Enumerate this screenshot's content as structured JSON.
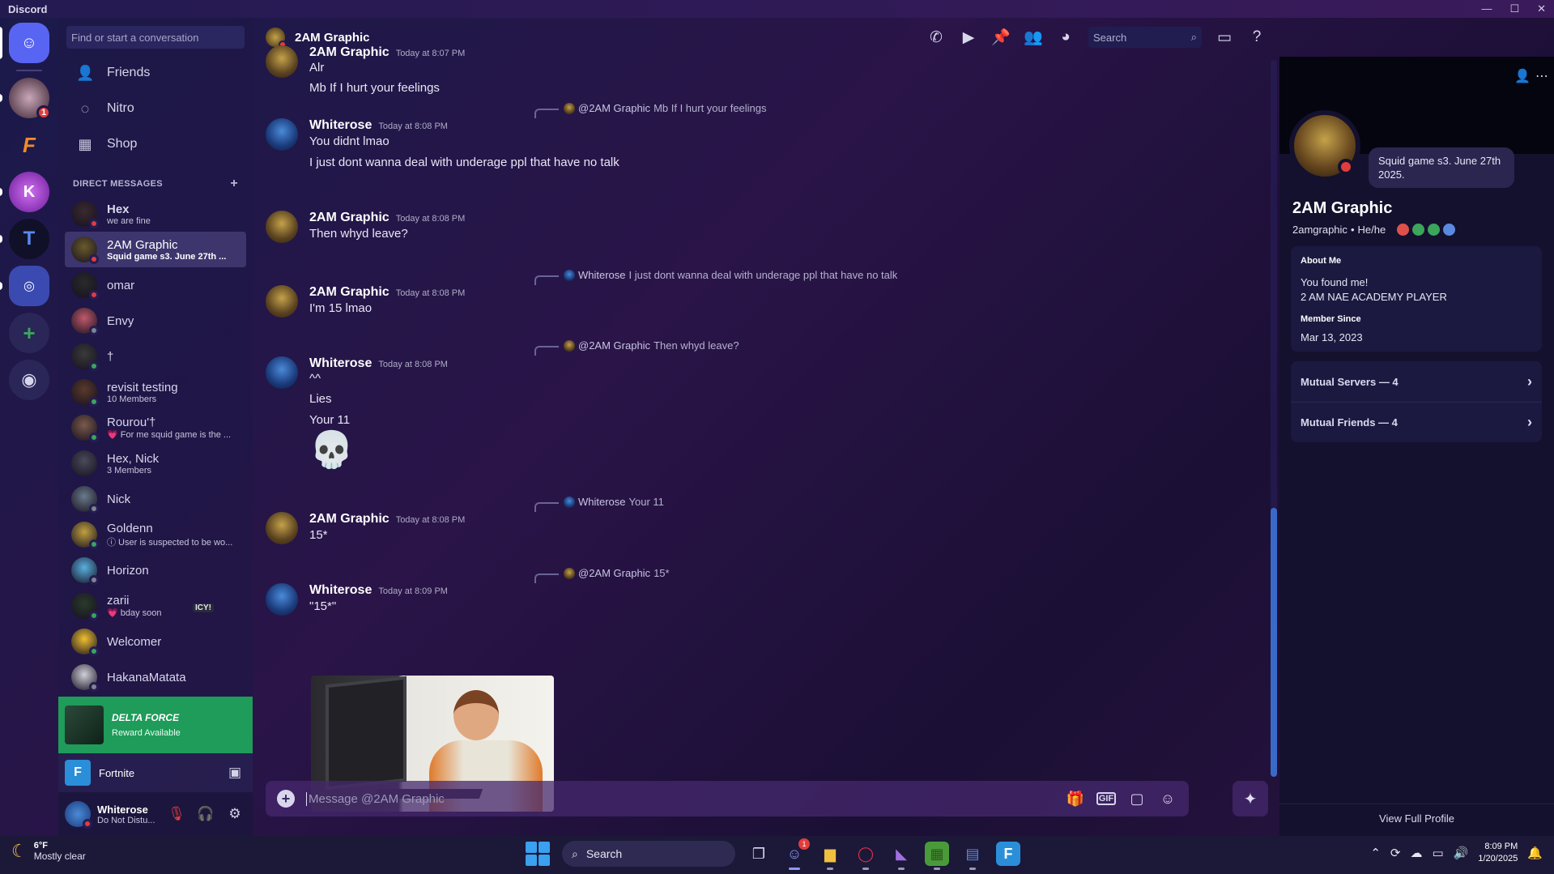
{
  "window": {
    "app_name": "Discord",
    "controls": [
      "—",
      "☐",
      "✕"
    ]
  },
  "servers": [
    {
      "name": "Direct Messages",
      "icon": "discord-logo-icon",
      "color": "#5865f2",
      "glyph": "☺"
    },
    {
      "name": "server-avatar",
      "badge": "1",
      "color": "#3a2a3a",
      "glyph": ""
    },
    {
      "name": "fortnite-server",
      "color": "#1c1838",
      "glyph": "F"
    },
    {
      "name": "k-server",
      "color": "#b03ad8",
      "glyph": "K"
    },
    {
      "name": "t-server",
      "color": "#1a1a2e",
      "glyph": "T"
    },
    {
      "name": "server-folder",
      "color": "#3a4ab0",
      "glyph": "◎"
    },
    {
      "name": "add-server",
      "color": "#2a2658",
      "glyph": "+"
    },
    {
      "name": "discover",
      "color": "#2a2658",
      "glyph": "◉"
    }
  ],
  "sidebar": {
    "search_placeholder": "Find or start a conversation",
    "nav": [
      {
        "label": "Friends",
        "icon": "friends-icon",
        "glyph": "👤"
      },
      {
        "label": "Nitro",
        "icon": "nitro-icon",
        "glyph": "◌"
      },
      {
        "label": "Shop",
        "icon": "shop-icon",
        "glyph": "▦"
      }
    ],
    "dm_header": "DIRECT MESSAGES",
    "dm_add": "+",
    "dms": [
      {
        "name": "Hex",
        "sub": "we are fine",
        "status": "dnd",
        "color": "#3a2a30",
        "bold": true
      },
      {
        "name": "2AM Graphic",
        "sub": "Squid game s3. June 27th ...",
        "status": "dnd",
        "color": "#6a5a2a",
        "active": true
      },
      {
        "name": "omar",
        "sub": "",
        "status": "dnd",
        "color": "#2a2a2a"
      },
      {
        "name": "Envy",
        "sub": "",
        "status": "off",
        "color": "#c05a6a"
      },
      {
        "name": "†",
        "sub": "",
        "status": "on",
        "color": "#3a3a3a"
      },
      {
        "name": "revisit testing",
        "sub": "10 Members",
        "status": "on",
        "color": "#5a3a2a"
      },
      {
        "name": "Rourou'†",
        "sub": "💗 For me squid game is the ...",
        "status": "on",
        "color": "#7a5a4a"
      },
      {
        "name": "Hex, Nick",
        "sub": "3 Members",
        "status": "",
        "color": "#4a4a5a"
      },
      {
        "name": "Nick",
        "sub": "",
        "status": "off",
        "color": "#6a7a8a"
      },
      {
        "name": "Goldenn",
        "sub": "ⓘ User is suspected to be wo...",
        "status": "on",
        "color": "#c0a040"
      },
      {
        "name": "Horizon",
        "sub": "",
        "status": "off",
        "color": "#5ab0e0"
      },
      {
        "name": "zarii",
        "sub": "💗 bday soon",
        "status": "on",
        "color": "#2a3a2a",
        "tag": "ICY!"
      },
      {
        "name": "Welcomer",
        "sub": "",
        "status": "on",
        "color": "#f0c030"
      },
      {
        "name": "HakanaMatata",
        "sub": "",
        "status": "off",
        "color": "#d0d0d8"
      }
    ]
  },
  "promo": {
    "title": "DELTA FORCE",
    "subtitle": "Reward Available"
  },
  "activity": {
    "name": "Fortnite",
    "glyph": "F"
  },
  "user": {
    "name": "Whiterose",
    "status": "Do Not Distu..."
  },
  "chat": {
    "channel_title": "2AM Graphic",
    "search_label": "Search",
    "composer_placeholder": "Message @2AM Graphic",
    "messages": [
      {
        "author": "2AM Graphic",
        "time": "Today at 8:07 PM",
        "lines": [
          "Alr",
          "Mb If I hurt your feelings"
        ],
        "avatar": "gfx"
      },
      {
        "reply_to": "@2AM Graphic",
        "reply_text": "Mb If I hurt your feelings",
        "author": "Whiterose",
        "time": "Today at 8:08 PM",
        "lines": [
          "You didnt lmao",
          "I just dont wanna deal with underage ppl that have no talk"
        ],
        "avatar": "wr"
      },
      {
        "author": "2AM Graphic",
        "time": "Today at 8:08 PM",
        "lines": [
          "Then whyd leave?"
        ],
        "avatar": "gfx"
      },
      {
        "reply_to": "Whiterose",
        "reply_text": "I just dont wanna deal with underage ppl that have no talk",
        "author": "2AM Graphic",
        "time": "Today at 8:08 PM",
        "lines": [
          "I'm 15 lmao"
        ],
        "avatar": "gfx"
      },
      {
        "reply_to": "@2AM Graphic",
        "reply_text": "Then whyd leave?",
        "author": "Whiterose",
        "time": "Today at 8:08 PM",
        "lines": [
          "^^",
          "Lies",
          "Your 11",
          "💀"
        ],
        "avatar": "wr"
      },
      {
        "reply_to": "Whiterose",
        "reply_text": "Your 11",
        "author": "2AM Graphic",
        "time": "Today at 8:08 PM",
        "lines": [
          "15*"
        ],
        "avatar": "gfx"
      },
      {
        "reply_to": "@2AM Graphic",
        "reply_text": "15*",
        "author": "Whiterose",
        "time": "Today at 8:09 PM",
        "lines": [
          "\"15*\""
        ],
        "avatar": "wr",
        "image": "child at computer"
      }
    ]
  },
  "profile": {
    "note": "Squid game s3. June 27th 2025.",
    "display_name": "2AM Graphic",
    "username": "2amgraphic",
    "pronouns": "He/he",
    "about_label": "About Me",
    "about_lines": [
      "You found me!",
      "2 AM NAE ACADEMY PLAYER"
    ],
    "member_since_label": "Member Since",
    "member_since": "Mar 13, 2023",
    "mutual_servers": "Mutual Servers — 4",
    "mutual_friends": "Mutual Friends — 4",
    "view_full": "View Full Profile",
    "badge_colors": [
      "#e0504a",
      "#3ba55c",
      "#3ba55c",
      "#5a8ae0"
    ]
  },
  "taskbar": {
    "temp": "6°F",
    "condition": "Mostly clear",
    "search_label": "Search",
    "discord_badge": "1",
    "time": "8:09 PM",
    "date": "1/20/2025"
  }
}
